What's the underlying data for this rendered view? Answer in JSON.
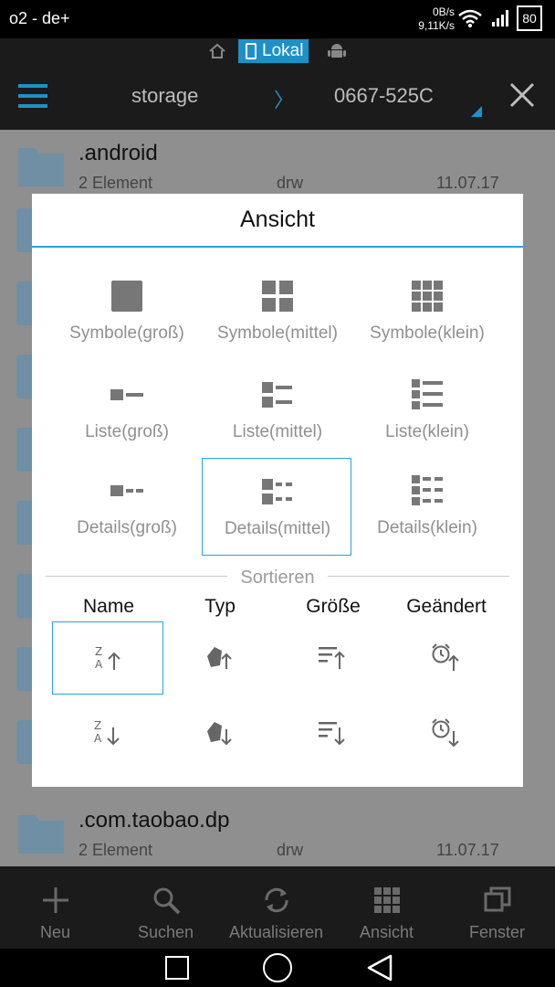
{
  "status": {
    "carrier": "o2 - de+",
    "up_speed": "0B/s",
    "down_speed": "9,11K/s",
    "battery": "80"
  },
  "location": {
    "active": "Lokal"
  },
  "toolbar": {
    "path": [
      "storage",
      "0667-525C"
    ],
    "separator": "〉"
  },
  "files": [
    {
      "name": ".android",
      "count": "2 Element",
      "perm": "drw",
      "date": "11.07.17"
    },
    {
      "name": ".com.taobao.dp",
      "count": "2 Element",
      "perm": "drw",
      "date": "11.07.17"
    }
  ],
  "dialog": {
    "title": "Ansicht",
    "views": [
      {
        "label": "Symbole(groß)",
        "icon": "grid-large-icon"
      },
      {
        "label": "Symbole(mittel)",
        "icon": "grid-medium-icon"
      },
      {
        "label": "Symbole(klein)",
        "icon": "grid-small-icon"
      },
      {
        "label": "Liste(groß)",
        "icon": "list-large-icon"
      },
      {
        "label": "Liste(mittel)",
        "icon": "list-medium-icon"
      },
      {
        "label": "Liste(klein)",
        "icon": "list-small-icon"
      },
      {
        "label": "Details(groß)",
        "icon": "details-large-icon"
      },
      {
        "label": "Details(mittel)",
        "icon": "details-medium-icon",
        "selected": true
      },
      {
        "label": "Details(klein)",
        "icon": "details-small-icon"
      }
    ],
    "sort_title": "Sortieren",
    "sort_columns": [
      "Name",
      "Typ",
      "Größe",
      "Geändert"
    ],
    "sort_selected": {
      "column": "Name",
      "direction": "ascending"
    },
    "accent": "#2aa4db"
  },
  "bottombar": [
    {
      "label": "Neu",
      "icon": "plus-icon"
    },
    {
      "label": "Suchen",
      "icon": "search-icon"
    },
    {
      "label": "Aktualisieren",
      "icon": "refresh-icon"
    },
    {
      "label": "Ansicht",
      "icon": "grid-icon"
    },
    {
      "label": "Fenster",
      "icon": "windows-icon"
    }
  ]
}
